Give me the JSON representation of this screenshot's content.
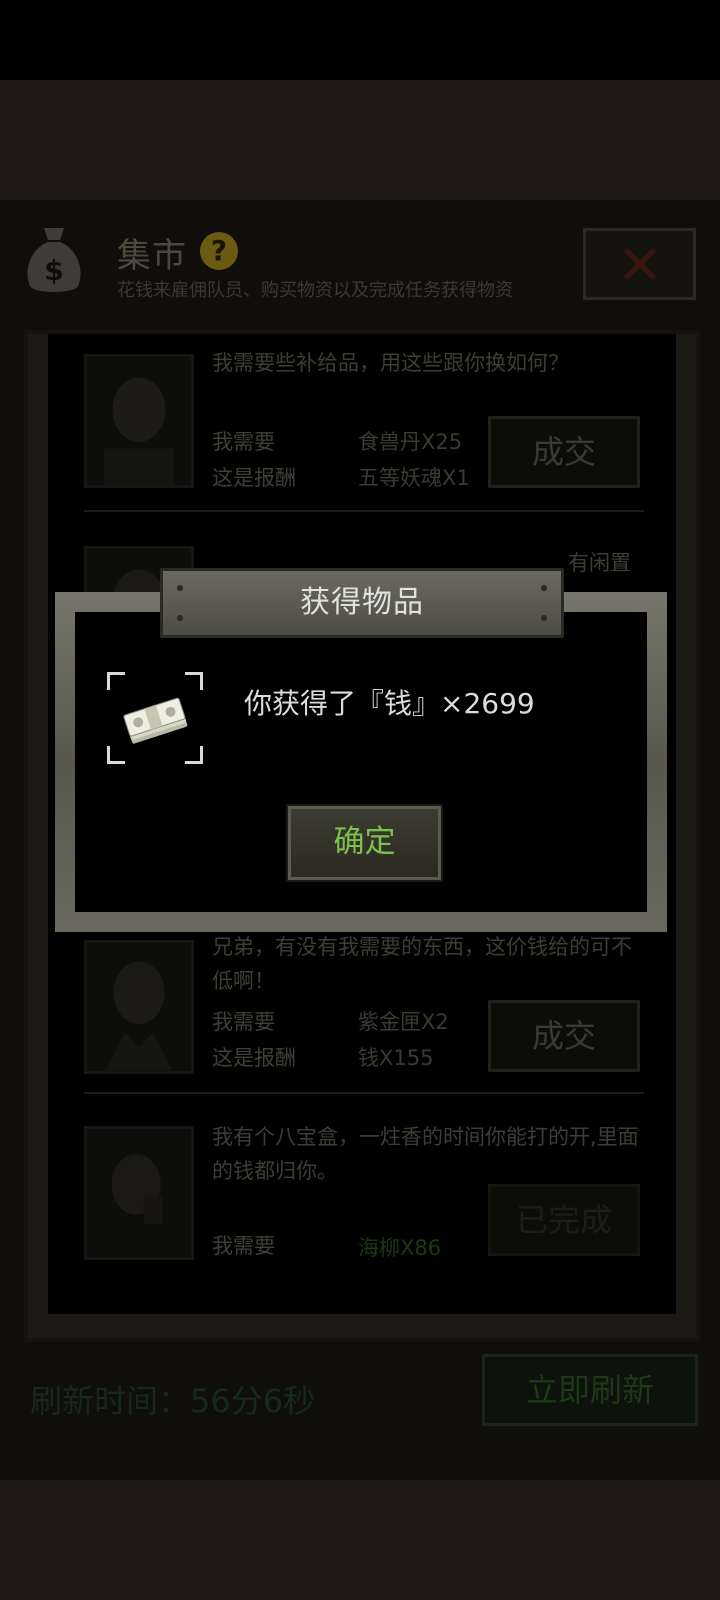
{
  "market": {
    "title": "集市",
    "subtitle": "花钱来雇佣队员、购买物资以及完成任务获得物资",
    "icons": {
      "money_bag": "money-bag-icon",
      "help": "help-icon",
      "close": "close-icon"
    },
    "help_symbol": "?",
    "need_label": "我需要",
    "reward_label": "这是报酬",
    "trades": [
      {
        "quote": "我需要些补给品，用这些跟你换如何？",
        "need": "食兽丹X25",
        "reward": "五等妖魂X1",
        "button": "成交"
      },
      {
        "quote": "有闲置",
        "need": "",
        "reward": "",
        "button": ""
      },
      {
        "quote": "兄弟，有没有我需要的东西，这价钱给的可不低啊！",
        "need": "紫金匣X2",
        "reward": "钱X155",
        "button": "成交"
      },
      {
        "quote": "我有个八宝盒，一炷香的时间你能打的开,里面的钱都归你。",
        "need": "海柳X86",
        "reward": "",
        "button": "已完成"
      }
    ],
    "refresh_time": "刷新时间：56分6秒",
    "refresh_button": "立即刷新"
  },
  "dialog": {
    "title": "获得物品",
    "reward_text": "你获得了『钱』×2699",
    "item_icon": "cash-stack-icon",
    "confirm": "确定"
  },
  "colors": {
    "confirm_text": "#7ec14a",
    "dialog_frame": "#6a695e",
    "background": "#0f0e0b"
  }
}
